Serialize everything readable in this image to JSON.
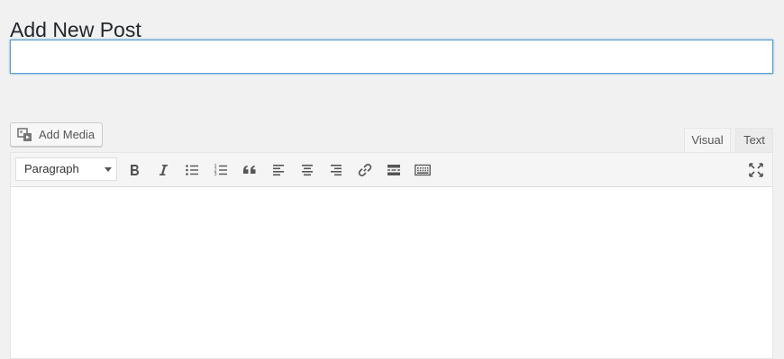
{
  "page": {
    "title": "Add New Post"
  },
  "title_field": {
    "value": "",
    "placeholder": ""
  },
  "media": {
    "add_media_label": "Add Media"
  },
  "editor_tabs": [
    {
      "label": "Visual",
      "active": true
    },
    {
      "label": "Text",
      "active": false
    }
  ],
  "toolbar": {
    "format_select_value": "Paragraph",
    "buttons": [
      {
        "name": "bold",
        "icon": "bold-icon"
      },
      {
        "name": "italic",
        "icon": "italic-icon"
      },
      {
        "name": "bulleted-list",
        "icon": "bulleted-list-icon"
      },
      {
        "name": "numbered-list",
        "icon": "numbered-list-icon"
      },
      {
        "name": "blockquote",
        "icon": "blockquote-icon"
      },
      {
        "name": "align-left",
        "icon": "align-left-icon"
      },
      {
        "name": "align-center",
        "icon": "align-center-icon"
      },
      {
        "name": "align-right",
        "icon": "align-right-icon"
      },
      {
        "name": "insert-link",
        "icon": "link-icon"
      },
      {
        "name": "insert-read-more",
        "icon": "read-more-icon"
      },
      {
        "name": "toolbar-toggle",
        "icon": "keyboard-icon"
      },
      {
        "name": "distraction-free",
        "icon": "fullscreen-icon"
      }
    ]
  },
  "editor": {
    "content": ""
  },
  "colors": {
    "background": "#f1f1f1",
    "focus_border": "#5b9dd9",
    "icon": "#555555"
  }
}
